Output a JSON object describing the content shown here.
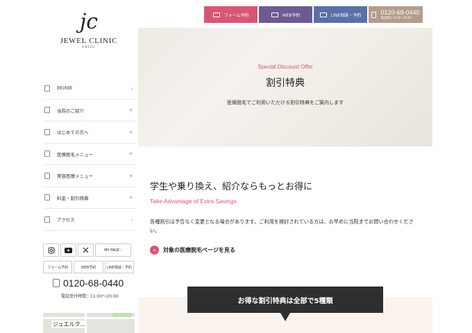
{
  "logo": {
    "mark": "jc",
    "name": "JEWEL CLINIC",
    "sub": "EBISU"
  },
  "nav": {
    "items": [
      {
        "label": "HOME",
        "arrow": "›"
      },
      {
        "label": "当院のご紹介",
        "arrow": "+"
      },
      {
        "label": "はじめての方へ",
        "arrow": "+"
      },
      {
        "label": "医療脱毛メニュー",
        "arrow": "+"
      },
      {
        "label": "美容医療メニュー",
        "arrow": "+"
      },
      {
        "label": "料金・割引特典",
        "arrow": "+"
      },
      {
        "label": "アクセス",
        "arrow": "›"
      }
    ]
  },
  "social": {
    "mypage": "MY PAGE ›"
  },
  "subbuttons": {
    "form": "フォーム予約",
    "web": "WEB予約",
    "line": "LINE相談・予約"
  },
  "sidebar_phone": {
    "number": "0120-68-0440",
    "hours": "電話受付時間：11:00〜20:00"
  },
  "map": {
    "label": "ジュエルク…"
  },
  "topbar": {
    "form": "フォーム予約",
    "web": "WEB予約",
    "line": "LINE相談・予約",
    "phone": "0120-68-0440",
    "phone_hours": "電話受付 11:00〜20:00"
  },
  "hero": {
    "en": "Special Discount Offer",
    "title": "割引特典",
    "desc": "医療脱毛でご利用いただける割引特典をご案内します"
  },
  "section": {
    "title": "学生や乗り換え、紹介ならもっとお得に",
    "en": "Take Advantage of Extra Savings",
    "para": "各種割引は予告なく変更となる場合があります。ご利用を検討されている方は、お早めに当院までお問い合わせください。",
    "link": "対象の医療脱毛ページを見る"
  },
  "banner": {
    "text": "お得な割引特典は全部で5種類"
  },
  "colors": {
    "accent": "#d85675",
    "dark": "#2f2f2f"
  }
}
